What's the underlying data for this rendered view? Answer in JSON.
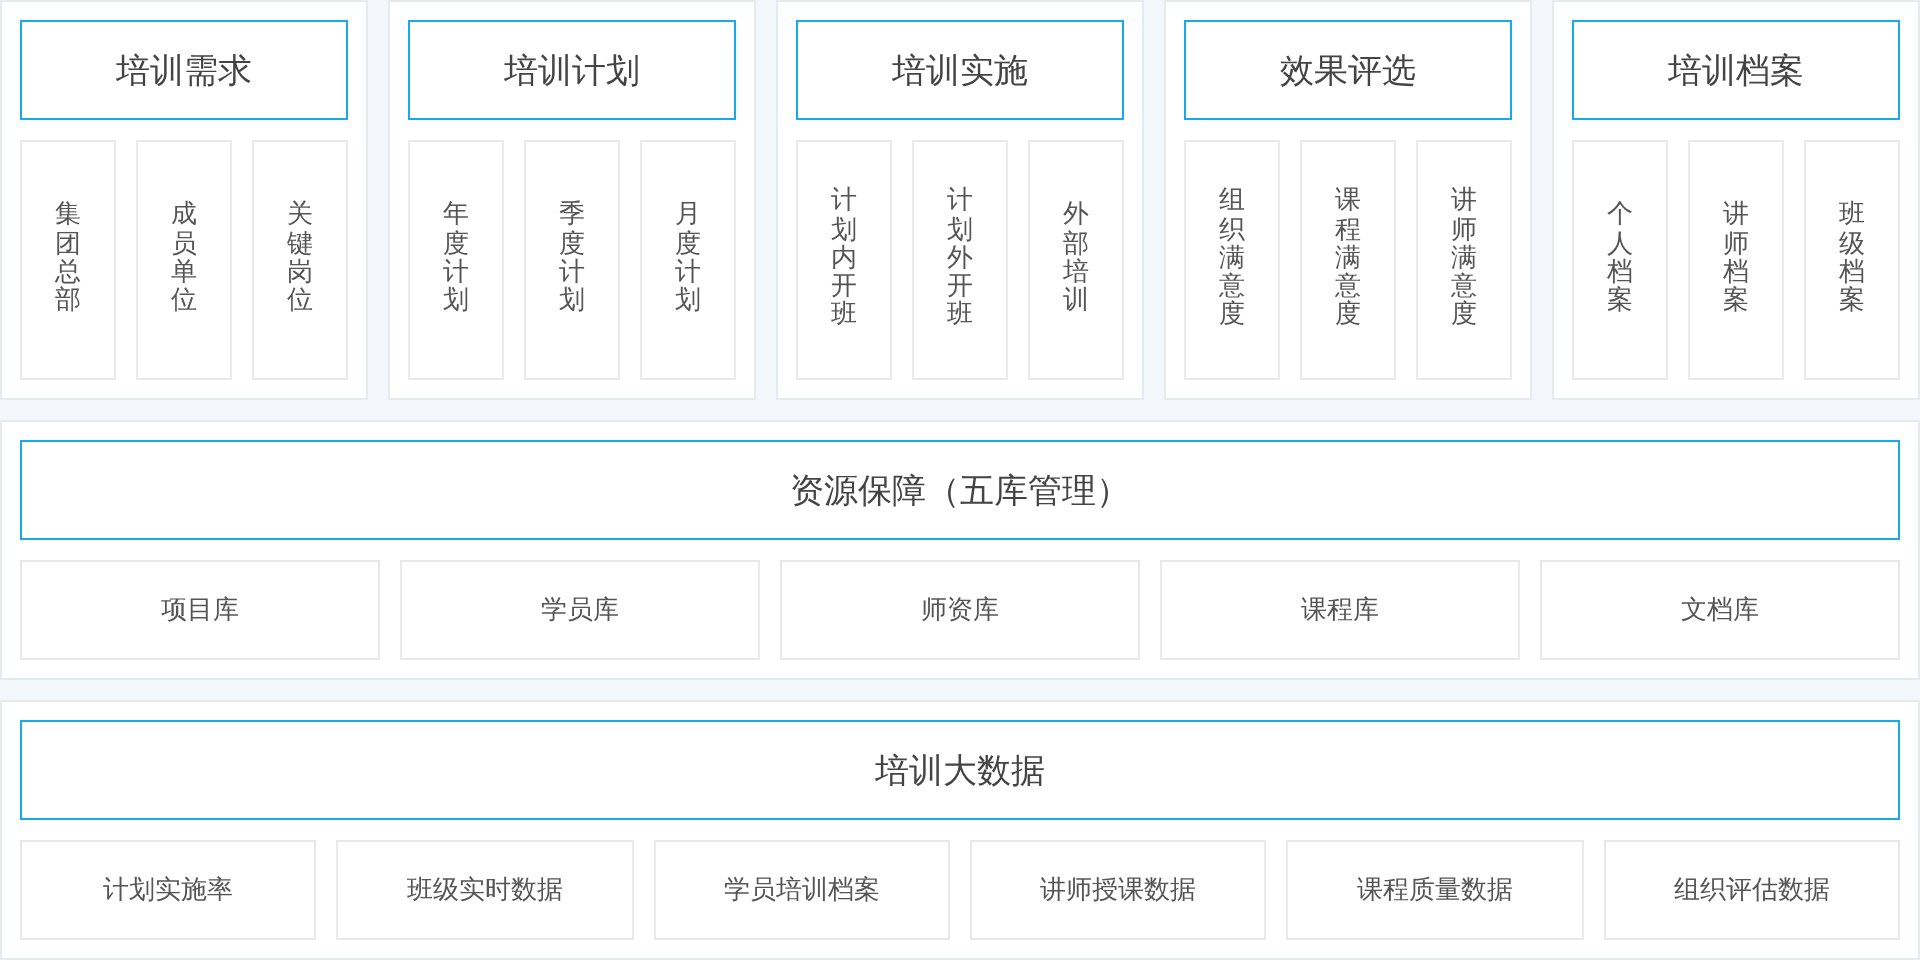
{
  "modules": [
    {
      "title": "培训需求",
      "items": [
        "集团总部",
        "成员单位",
        "关键岗位"
      ]
    },
    {
      "title": "培训计划",
      "items": [
        "年度计划",
        "季度计划",
        "月度计划"
      ]
    },
    {
      "title": "培训实施",
      "items": [
        "计划内开班",
        "计划外开班",
        "外部培训"
      ]
    },
    {
      "title": "效果评选",
      "items": [
        "组织满意度",
        "课程满意度",
        "讲师满意度"
      ]
    },
    {
      "title": "培训档案",
      "items": [
        "个人档案",
        "讲师档案",
        "班级档案"
      ]
    }
  ],
  "sections": [
    {
      "title": "资源保障（五库管理）",
      "items": [
        "项目库",
        "学员库",
        "师资库",
        "课程库",
        "文档库"
      ]
    },
    {
      "title": "培训大数据",
      "items": [
        "计划实施率",
        "班级实时数据",
        "学员培训档案",
        "讲师授课数据",
        "课程质量数据",
        "组织评估数据"
      ]
    }
  ]
}
